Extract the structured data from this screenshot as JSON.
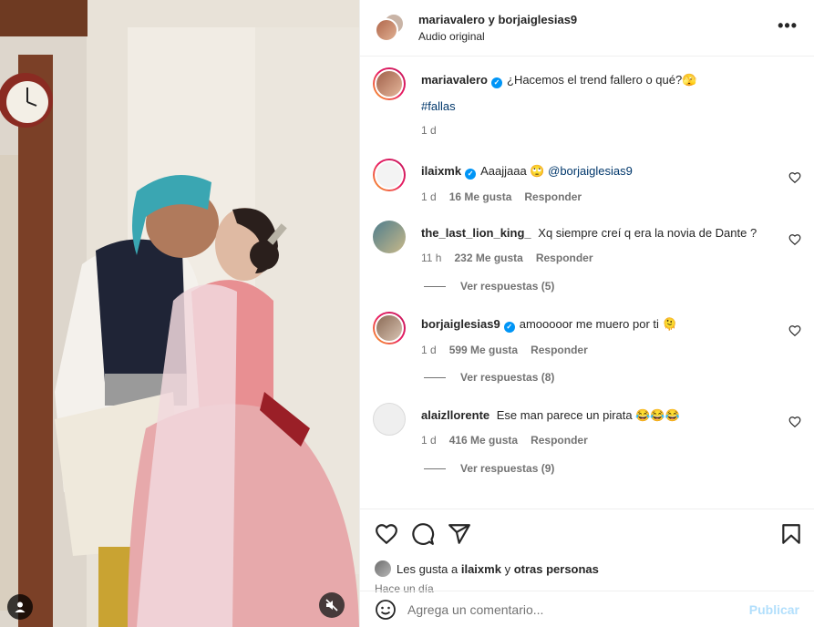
{
  "header": {
    "names": "mariavalero y borjaiglesias9",
    "audio": "Audio original",
    "more_icon": "more-icon"
  },
  "caption": {
    "username": "mariavalero",
    "text": "¿Hacemos el trend fallero o qué?🫣",
    "hashtag": "#fallas",
    "time": "1 d"
  },
  "comments": [
    {
      "username": "ilaixmk",
      "verified": true,
      "text": "Aaajjaaa 🙄",
      "mention": "@borjaiglesias9",
      "time": "1 d",
      "likes": "16 Me gusta",
      "reply": "Responder"
    },
    {
      "username": "the_last_lion_king_",
      "verified": false,
      "text": "Xq siempre creí q era la novia de Dante ?",
      "time": "11 h",
      "likes": "232 Me gusta",
      "reply": "Responder",
      "view_replies": "Ver respuestas (5)"
    },
    {
      "username": "borjaiglesias9",
      "verified": true,
      "text": "amooooor me muero por ti 🫠",
      "time": "1 d",
      "likes": "599 Me gusta",
      "reply": "Responder",
      "view_replies": "Ver respuestas (8)"
    },
    {
      "username": "alaizllorente",
      "verified": false,
      "text": "Ese man parece un pirata 😂😂😂",
      "time": "1 d",
      "likes": "416 Me gusta",
      "reply": "Responder",
      "view_replies": "Ver respuestas (9)"
    }
  ],
  "actions": {
    "likes_prefix": "Les gusta a",
    "likes_user": "ilaixmk",
    "likes_joiner": "y",
    "likes_others": "otras personas",
    "time": "Hace un día"
  },
  "add_comment": {
    "placeholder": "Agrega un comentario...",
    "post_label": "Publicar"
  }
}
